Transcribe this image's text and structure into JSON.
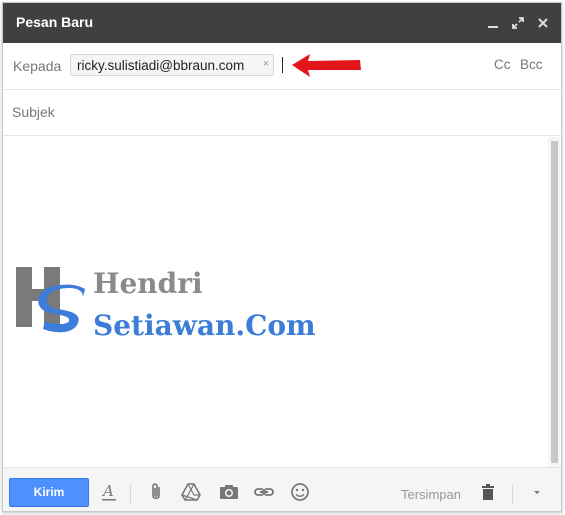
{
  "window": {
    "title": "Pesan Baru"
  },
  "compose": {
    "to_label": "Kepada",
    "recipient": "ricky.sulistiadi@bbraun.com",
    "recipient_remove": "×",
    "cc_label": "Cc",
    "bcc_label": "Bcc",
    "subject_placeholder": "Subjek",
    "subject_value": ""
  },
  "watermark": {
    "line1": "Hendri",
    "line2": "Setiawan.Com",
    "logo_letters": "HS"
  },
  "toolbar": {
    "send_label": "Kirim",
    "saved_status": "Tersimpan"
  },
  "colors": {
    "titlebar": "#404040",
    "send_button": "#4d90fe",
    "annotation_arrow": "#e3161b",
    "watermark_gray": "#7a7a7a",
    "watermark_blue": "#3b7dd8"
  },
  "icons": {
    "minimize": "minimize-icon",
    "fullscreen": "expand-icon",
    "close": "close-icon",
    "formatting": "text-format-icon",
    "attach": "paperclip-icon",
    "drive": "google-drive-icon",
    "photo": "camera-icon",
    "link": "link-icon",
    "emoji": "smiley-icon",
    "discard": "trash-icon",
    "more": "chevron-down-icon"
  }
}
